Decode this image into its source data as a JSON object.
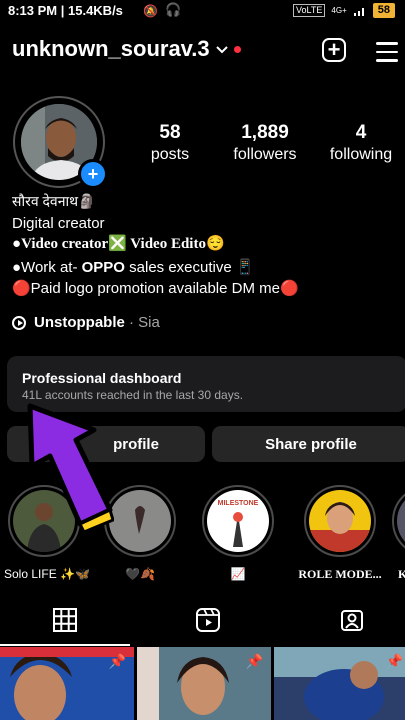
{
  "status_bar": {
    "time": "8:13 PM | 15.4KB/s",
    "sim": "VoLTE",
    "network": "4G+",
    "battery": "58"
  },
  "header": {
    "username": "unknown_sourav.3"
  },
  "stats": [
    {
      "value": "58",
      "label": "posts"
    },
    {
      "value": "1,889",
      "label": "followers"
    },
    {
      "value": "4",
      "label": "following"
    }
  ],
  "bio": {
    "name": "सौरव देवनाथ🗿",
    "category": "Digital creator",
    "line1_prefix": "●",
    "line1": "Video creator❎ Video Edito😌",
    "line2_prefix": "●Work at- ",
    "line2_bold": "OPPO",
    "line2_suffix": " sales executive 📱",
    "line3": "🔴Paid logo promotion available DM me🔴",
    "music_title": "Unstoppable",
    "music_artist": " · Sia"
  },
  "dashboard": {
    "title": "Professional dashboard",
    "subtitle": "41L accounts reached in the last 30 days."
  },
  "buttons": {
    "edit": "profile",
    "share": "Share profile"
  },
  "highlights": [
    {
      "label": "Solo LIFE ✨🦋"
    },
    {
      "label": "🖤🍂"
    },
    {
      "label": "📈",
      "badge": "MILESTONE"
    },
    {
      "label": "ROLE MODE..."
    },
    {
      "label": "K"
    }
  ],
  "colors": {
    "accent_blue": "#1a8cff",
    "notification_red": "#ff3040",
    "arrow_purple": "#8b2be2",
    "arrow_yellow": "#ffd21f"
  }
}
